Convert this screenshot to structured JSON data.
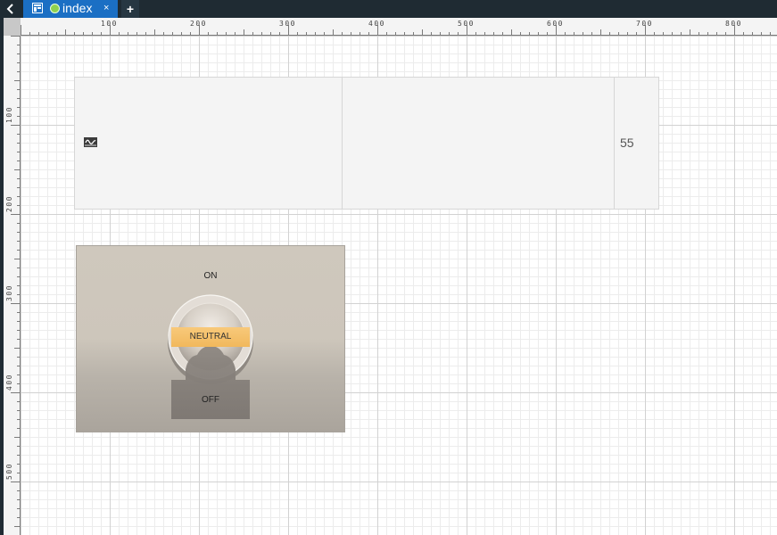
{
  "tabbar": {
    "back_icon": "chevron-left-icon",
    "tab": {
      "label": "index",
      "close": "×",
      "page_icon": "page-layout-icon",
      "status_color": "#8fd14f"
    },
    "add_label": "+"
  },
  "rulers": {
    "top_labels": [
      "100",
      "200",
      "300",
      "400",
      "500",
      "600",
      "700",
      "800"
    ],
    "left_labels": [
      "100",
      "200",
      "300",
      "400",
      "500"
    ]
  },
  "trend_widget": {
    "icon": "waveform-icon",
    "value": "55"
  },
  "switch_widget": {
    "on_label": "ON",
    "neutral_label": "NEUTRAL",
    "off_label": "OFF",
    "accent_color": "#f5c16c"
  },
  "colors": {
    "tab_active": "#1b6fc4",
    "tab_bar": "#1f2b33"
  }
}
